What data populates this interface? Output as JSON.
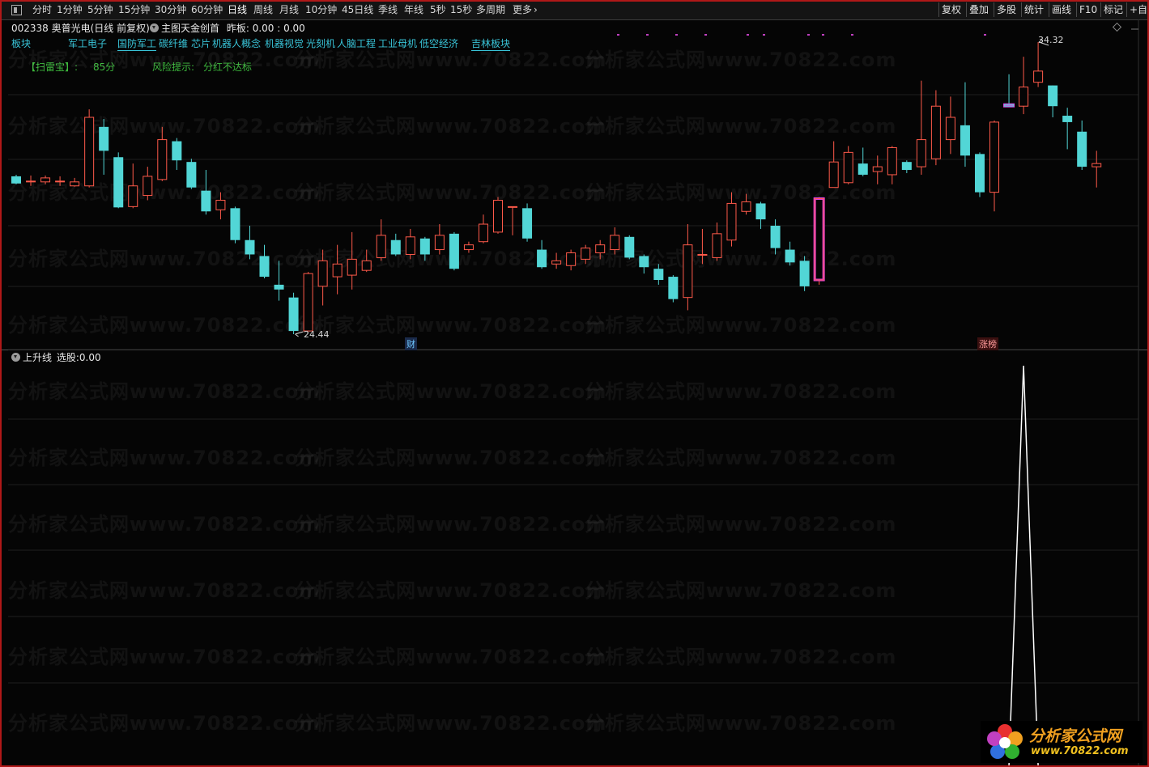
{
  "toolbar": {
    "periods": [
      "分时",
      "1分钟",
      "5分钟",
      "15分钟",
      "30分钟",
      "60分钟",
      "日线",
      "周线",
      "月线",
      "10分钟",
      "45日线",
      "季线",
      "年线",
      "5秒",
      "15秒",
      "多周期",
      "更多"
    ],
    "active_period": "日线",
    "right_buttons": [
      "复权",
      "叠加",
      "多股",
      "统计",
      "画线",
      "F10",
      "标记",
      "+自"
    ]
  },
  "header": {
    "stock_line": "002338 奥普光电(日线 前复权)",
    "indicator_name": "主图天金创首",
    "indicator_value": "昨板: 0.00 : 0.00"
  },
  "sectors": {
    "label": "板块",
    "items": [
      "军工电子",
      "国防军工",
      "碳纤维",
      "芯片",
      "机器人概念",
      "机器视觉",
      "光刻机",
      "人脑工程",
      "工业母机",
      "低空经济",
      "吉林板块"
    ]
  },
  "scan": {
    "label": "【扫雷宝】:",
    "score": "85分",
    "risk_label": "风险提示:",
    "risk_value": "分红不达标"
  },
  "price_labels": {
    "high": "34.32",
    "low": "24.44"
  },
  "markers": {
    "finance": "财",
    "limit": "涨榜"
  },
  "sub_panel": {
    "title": "上升线",
    "select_label": "选股:",
    "select_value": "0.00"
  },
  "watermark": "分析家公式网www.70822.com",
  "logo": {
    "name": "分析家公式网",
    "url": "www.70822.com"
  },
  "colors": {
    "up": "#ff5a4a",
    "down": "#52d6d6",
    "highlight": "#e040e0",
    "signal": "#ffffff",
    "sector": "#39c4d8",
    "scan": "#3cb83c"
  },
  "chart_data": {
    "type": "candlestick",
    "series": [
      {
        "o": 25.9,
        "c": 25.45,
        "h": 26.0,
        "l": 25.4
      },
      {
        "o": 25.6,
        "c": 25.6,
        "h": 25.95,
        "l": 25.3
      },
      {
        "o": 25.55,
        "c": 25.8,
        "h": 25.95,
        "l": 25.4
      },
      {
        "o": 25.6,
        "c": 25.6,
        "h": 25.9,
        "l": 25.3
      },
      {
        "o": 25.3,
        "c": 25.55,
        "h": 25.8,
        "l": 25.25
      },
      {
        "o": 25.3,
        "c": 29.6,
        "h": 30.1,
        "l": 25.2
      },
      {
        "o": 29.0,
        "c": 27.5,
        "h": 29.5,
        "l": 26.0
      },
      {
        "o": 27.1,
        "c": 23.95,
        "h": 27.4,
        "l": 23.9
      },
      {
        "o": 24.0,
        "c": 25.3,
        "h": 26.7,
        "l": 23.9
      },
      {
        "o": 24.7,
        "c": 25.9,
        "h": 26.5,
        "l": 24.4
      },
      {
        "o": 25.7,
        "c": 28.2,
        "h": 29.0,
        "l": 25.6
      },
      {
        "o": 28.1,
        "c": 26.9,
        "h": 28.3,
        "l": 26.3
      },
      {
        "o": 26.8,
        "c": 25.2,
        "h": 27.0,
        "l": 25.1
      },
      {
        "o": 25.0,
        "c": 23.7,
        "h": 26.3,
        "l": 23.5
      },
      {
        "o": 23.8,
        "c": 24.4,
        "h": 24.9,
        "l": 23.2
      },
      {
        "o": 23.9,
        "c": 21.9,
        "h": 24.0,
        "l": 21.7
      },
      {
        "o": 21.9,
        "c": 21.0,
        "h": 22.8,
        "l": 20.7
      },
      {
        "o": 20.9,
        "c": 19.6,
        "h": 21.6,
        "l": 19.5
      },
      {
        "o": 19.1,
        "c": 18.8,
        "h": 20.6,
        "l": 18.1
      },
      {
        "o": 18.3,
        "c": 16.2,
        "h": 18.6,
        "l": 16.0
      },
      {
        "o": 16.2,
        "c": 19.8,
        "h": 19.9,
        "l": 16.2
      },
      {
        "o": 19.0,
        "c": 20.6,
        "h": 21.3,
        "l": 17.8
      },
      {
        "o": 19.6,
        "c": 20.4,
        "h": 21.6,
        "l": 18.5
      },
      {
        "o": 19.7,
        "c": 20.7,
        "h": 22.4,
        "l": 18.8
      },
      {
        "o": 20.0,
        "c": 20.6,
        "h": 21.3,
        "l": 19.9
      },
      {
        "o": 20.8,
        "c": 22.2,
        "h": 23.2,
        "l": 20.6
      },
      {
        "o": 21.9,
        "c": 21.0,
        "h": 22.3,
        "l": 20.9
      },
      {
        "o": 21.0,
        "c": 22.1,
        "h": 22.6,
        "l": 20.7
      },
      {
        "o": 22.0,
        "c": 21.0,
        "h": 22.1,
        "l": 20.6
      },
      {
        "o": 21.3,
        "c": 22.2,
        "h": 22.9,
        "l": 21.0
      },
      {
        "o": 22.3,
        "c": 20.1,
        "h": 22.4,
        "l": 20.0
      },
      {
        "o": 21.3,
        "c": 21.6,
        "h": 21.8,
        "l": 21.1
      },
      {
        "o": 21.8,
        "c": 22.9,
        "h": 23.5,
        "l": 21.7
      },
      {
        "o": 22.4,
        "c": 24.4,
        "h": 24.6,
        "l": 22.3
      },
      {
        "o": 24.0,
        "c": 24.0,
        "h": 24.0,
        "l": 22.2
      },
      {
        "o": 23.9,
        "c": 22.0,
        "h": 24.2,
        "l": 21.8
      },
      {
        "o": 21.3,
        "c": 20.2,
        "h": 21.9,
        "l": 20.1
      },
      {
        "o": 20.4,
        "c": 20.6,
        "h": 21.1,
        "l": 20.1
      },
      {
        "o": 20.3,
        "c": 21.1,
        "h": 21.3,
        "l": 20.0
      },
      {
        "o": 20.7,
        "c": 21.4,
        "h": 21.6,
        "l": 20.4
      },
      {
        "o": 21.1,
        "c": 21.6,
        "h": 21.9,
        "l": 20.7
      },
      {
        "o": 21.3,
        "c": 22.2,
        "h": 22.7,
        "l": 21.0
      },
      {
        "o": 22.1,
        "c": 20.8,
        "h": 22.2,
        "l": 20.7
      },
      {
        "o": 20.9,
        "c": 20.2,
        "h": 21.0,
        "l": 19.8
      },
      {
        "o": 20.1,
        "c": 19.4,
        "h": 20.4,
        "l": 19.1
      },
      {
        "o": 19.6,
        "c": 18.2,
        "h": 19.7,
        "l": 18.0
      },
      {
        "o": 18.3,
        "c": 21.6,
        "h": 22.9,
        "l": 17.5
      },
      {
        "o": 21.0,
        "c": 21.0,
        "h": 22.6,
        "l": 20.4
      },
      {
        "o": 20.8,
        "c": 22.3,
        "h": 23.0,
        "l": 20.6
      },
      {
        "o": 21.9,
        "c": 24.2,
        "h": 24.9,
        "l": 21.5
      },
      {
        "o": 23.7,
        "c": 24.3,
        "h": 24.8,
        "l": 23.5
      },
      {
        "o": 24.2,
        "c": 23.2,
        "h": 24.3,
        "l": 22.6
      },
      {
        "o": 22.8,
        "c": 21.4,
        "h": 23.2,
        "l": 21.0
      },
      {
        "o": 21.3,
        "c": 20.5,
        "h": 21.8,
        "l": 20.3
      },
      {
        "o": 20.6,
        "c": 19.0,
        "h": 20.9,
        "l": 18.7
      },
      {
        "o": 19.4,
        "c": 24.5,
        "h": 24.6,
        "l": 19.1
      },
      {
        "o": 25.2,
        "c": 26.8,
        "h": 28.1,
        "l": 25.2
      },
      {
        "o": 25.5,
        "c": 27.4,
        "h": 27.8,
        "l": 25.4
      },
      {
        "o": 26.7,
        "c": 26.0,
        "h": 27.7,
        "l": 25.9
      },
      {
        "o": 26.2,
        "c": 26.5,
        "h": 27.2,
        "l": 25.4
      },
      {
        "o": 26.0,
        "c": 27.7,
        "h": 27.8,
        "l": 25.4
      },
      {
        "o": 26.8,
        "c": 26.3,
        "h": 26.9,
        "l": 26.1
      },
      {
        "o": 26.5,
        "c": 28.2,
        "h": 31.9,
        "l": 26.0
      },
      {
        "o": 27.0,
        "c": 30.3,
        "h": 31.3,
        "l": 26.6
      },
      {
        "o": 28.2,
        "c": 29.6,
        "h": 30.9,
        "l": 27.3
      },
      {
        "o": 29.1,
        "c": 27.2,
        "h": 31.8,
        "l": 26.5
      },
      {
        "o": 27.3,
        "c": 24.9,
        "h": 27.4,
        "l": 24.6
      },
      {
        "o": 24.9,
        "c": 29.3,
        "h": 29.4,
        "l": 23.7
      },
      {
        "o": 30.4,
        "c": 30.3,
        "h": 32.3,
        "l": 30.4
      },
      {
        "o": 30.3,
        "c": 31.5,
        "h": 33.4,
        "l": 29.8
      },
      {
        "o": 31.8,
        "c": 32.5,
        "h": 34.32,
        "l": 31.5
      },
      {
        "o": 31.6,
        "c": 30.3,
        "h": 31.6,
        "l": 29.6
      },
      {
        "o": 29.7,
        "c": 29.3,
        "h": 30.2,
        "l": 27.6
      },
      {
        "o": 28.7,
        "c": 26.5,
        "h": 29.4,
        "l": 26.3
      },
      {
        "o": 26.5,
        "c": 26.7,
        "h": 27.5,
        "l": 25.2
      }
    ],
    "highlight_indices": [
      55,
      68
    ],
    "ylim": [
      16.0,
      34.32
    ],
    "sub_signal": {
      "name": "上升线",
      "peak_index": 69,
      "value": 0.0
    }
  }
}
